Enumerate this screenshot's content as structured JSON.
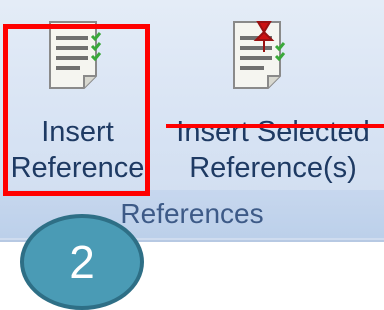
{
  "ribbon": {
    "group_label": "References",
    "insert_reference": {
      "line1": "Insert",
      "line2": "Reference",
      "icon": "document-check-icon"
    },
    "insert_selected": {
      "line1": "Insert Selected",
      "line2": "Reference(s)",
      "icon": "document-check-pin-icon"
    }
  },
  "annotation": {
    "step_number": "2",
    "highlight_color": "#ff0000",
    "badge_color": "#4a9bb5"
  }
}
